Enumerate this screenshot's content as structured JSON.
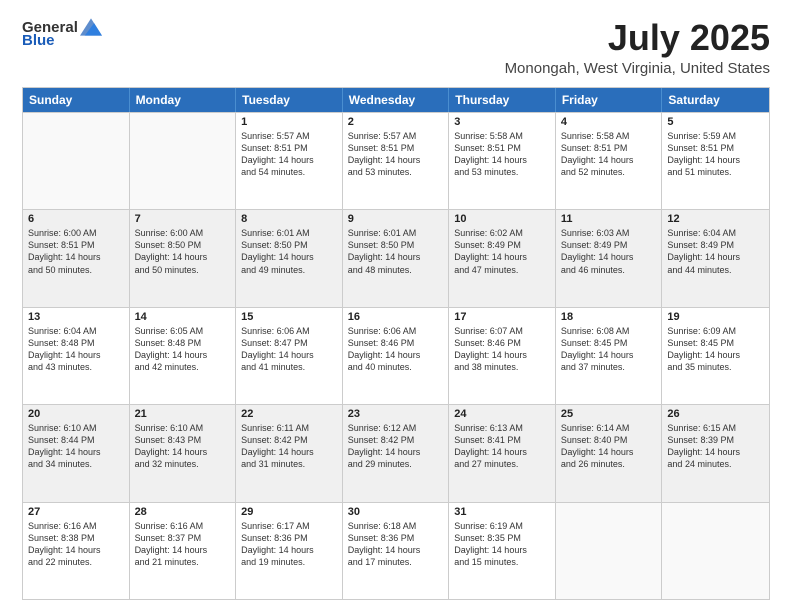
{
  "logo": {
    "general": "General",
    "blue": "Blue"
  },
  "title": "July 2025",
  "subtitle": "Monongah, West Virginia, United States",
  "header_days": [
    "Sunday",
    "Monday",
    "Tuesday",
    "Wednesday",
    "Thursday",
    "Friday",
    "Saturday"
  ],
  "weeks": [
    [
      {
        "day": "",
        "lines": [],
        "empty": true
      },
      {
        "day": "",
        "lines": [],
        "empty": true
      },
      {
        "day": "1",
        "lines": [
          "Sunrise: 5:57 AM",
          "Sunset: 8:51 PM",
          "Daylight: 14 hours",
          "and 54 minutes."
        ]
      },
      {
        "day": "2",
        "lines": [
          "Sunrise: 5:57 AM",
          "Sunset: 8:51 PM",
          "Daylight: 14 hours",
          "and 53 minutes."
        ]
      },
      {
        "day": "3",
        "lines": [
          "Sunrise: 5:58 AM",
          "Sunset: 8:51 PM",
          "Daylight: 14 hours",
          "and 53 minutes."
        ]
      },
      {
        "day": "4",
        "lines": [
          "Sunrise: 5:58 AM",
          "Sunset: 8:51 PM",
          "Daylight: 14 hours",
          "and 52 minutes."
        ]
      },
      {
        "day": "5",
        "lines": [
          "Sunrise: 5:59 AM",
          "Sunset: 8:51 PM",
          "Daylight: 14 hours",
          "and 51 minutes."
        ]
      }
    ],
    [
      {
        "day": "6",
        "lines": [
          "Sunrise: 6:00 AM",
          "Sunset: 8:51 PM",
          "Daylight: 14 hours",
          "and 50 minutes."
        ]
      },
      {
        "day": "7",
        "lines": [
          "Sunrise: 6:00 AM",
          "Sunset: 8:50 PM",
          "Daylight: 14 hours",
          "and 50 minutes."
        ]
      },
      {
        "day": "8",
        "lines": [
          "Sunrise: 6:01 AM",
          "Sunset: 8:50 PM",
          "Daylight: 14 hours",
          "and 49 minutes."
        ]
      },
      {
        "day": "9",
        "lines": [
          "Sunrise: 6:01 AM",
          "Sunset: 8:50 PM",
          "Daylight: 14 hours",
          "and 48 minutes."
        ]
      },
      {
        "day": "10",
        "lines": [
          "Sunrise: 6:02 AM",
          "Sunset: 8:49 PM",
          "Daylight: 14 hours",
          "and 47 minutes."
        ]
      },
      {
        "day": "11",
        "lines": [
          "Sunrise: 6:03 AM",
          "Sunset: 8:49 PM",
          "Daylight: 14 hours",
          "and 46 minutes."
        ]
      },
      {
        "day": "12",
        "lines": [
          "Sunrise: 6:04 AM",
          "Sunset: 8:49 PM",
          "Daylight: 14 hours",
          "and 44 minutes."
        ]
      }
    ],
    [
      {
        "day": "13",
        "lines": [
          "Sunrise: 6:04 AM",
          "Sunset: 8:48 PM",
          "Daylight: 14 hours",
          "and 43 minutes."
        ]
      },
      {
        "day": "14",
        "lines": [
          "Sunrise: 6:05 AM",
          "Sunset: 8:48 PM",
          "Daylight: 14 hours",
          "and 42 minutes."
        ]
      },
      {
        "day": "15",
        "lines": [
          "Sunrise: 6:06 AM",
          "Sunset: 8:47 PM",
          "Daylight: 14 hours",
          "and 41 minutes."
        ]
      },
      {
        "day": "16",
        "lines": [
          "Sunrise: 6:06 AM",
          "Sunset: 8:46 PM",
          "Daylight: 14 hours",
          "and 40 minutes."
        ]
      },
      {
        "day": "17",
        "lines": [
          "Sunrise: 6:07 AM",
          "Sunset: 8:46 PM",
          "Daylight: 14 hours",
          "and 38 minutes."
        ]
      },
      {
        "day": "18",
        "lines": [
          "Sunrise: 6:08 AM",
          "Sunset: 8:45 PM",
          "Daylight: 14 hours",
          "and 37 minutes."
        ]
      },
      {
        "day": "19",
        "lines": [
          "Sunrise: 6:09 AM",
          "Sunset: 8:45 PM",
          "Daylight: 14 hours",
          "and 35 minutes."
        ]
      }
    ],
    [
      {
        "day": "20",
        "lines": [
          "Sunrise: 6:10 AM",
          "Sunset: 8:44 PM",
          "Daylight: 14 hours",
          "and 34 minutes."
        ]
      },
      {
        "day": "21",
        "lines": [
          "Sunrise: 6:10 AM",
          "Sunset: 8:43 PM",
          "Daylight: 14 hours",
          "and 32 minutes."
        ]
      },
      {
        "day": "22",
        "lines": [
          "Sunrise: 6:11 AM",
          "Sunset: 8:42 PM",
          "Daylight: 14 hours",
          "and 31 minutes."
        ]
      },
      {
        "day": "23",
        "lines": [
          "Sunrise: 6:12 AM",
          "Sunset: 8:42 PM",
          "Daylight: 14 hours",
          "and 29 minutes."
        ]
      },
      {
        "day": "24",
        "lines": [
          "Sunrise: 6:13 AM",
          "Sunset: 8:41 PM",
          "Daylight: 14 hours",
          "and 27 minutes."
        ]
      },
      {
        "day": "25",
        "lines": [
          "Sunrise: 6:14 AM",
          "Sunset: 8:40 PM",
          "Daylight: 14 hours",
          "and 26 minutes."
        ]
      },
      {
        "day": "26",
        "lines": [
          "Sunrise: 6:15 AM",
          "Sunset: 8:39 PM",
          "Daylight: 14 hours",
          "and 24 minutes."
        ]
      }
    ],
    [
      {
        "day": "27",
        "lines": [
          "Sunrise: 6:16 AM",
          "Sunset: 8:38 PM",
          "Daylight: 14 hours",
          "and 22 minutes."
        ]
      },
      {
        "day": "28",
        "lines": [
          "Sunrise: 6:16 AM",
          "Sunset: 8:37 PM",
          "Daylight: 14 hours",
          "and 21 minutes."
        ]
      },
      {
        "day": "29",
        "lines": [
          "Sunrise: 6:17 AM",
          "Sunset: 8:36 PM",
          "Daylight: 14 hours",
          "and 19 minutes."
        ]
      },
      {
        "day": "30",
        "lines": [
          "Sunrise: 6:18 AM",
          "Sunset: 8:36 PM",
          "Daylight: 14 hours",
          "and 17 minutes."
        ]
      },
      {
        "day": "31",
        "lines": [
          "Sunrise: 6:19 AM",
          "Sunset: 8:35 PM",
          "Daylight: 14 hours",
          "and 15 minutes."
        ]
      },
      {
        "day": "",
        "lines": [],
        "empty": true
      },
      {
        "day": "",
        "lines": [],
        "empty": true
      }
    ]
  ]
}
